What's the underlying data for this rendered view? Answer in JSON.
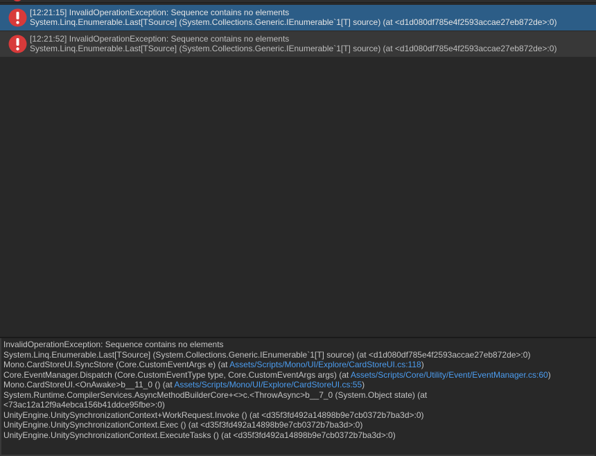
{
  "log_entries": [
    {
      "timestamp": "[12:21:15]",
      "message": "InvalidOperationException: Sequence contains no elements",
      "stack_first": "System.Linq.Enumerable.Last[TSource] (System.Collections.Generic.IEnumerable`1[T] source) (at <d1d080df785e4f2593accae27eb872de>:0)",
      "selected": true,
      "icon": "error-icon"
    },
    {
      "timestamp": "[12:21:52]",
      "message": "InvalidOperationException: Sequence contains no elements",
      "stack_first": "System.Linq.Enumerable.Last[TSource] (System.Collections.Generic.IEnumerable`1[T] source) (at <d1d080df785e4f2593accae27eb872de>:0)",
      "selected": false,
      "icon": "error-icon"
    }
  ],
  "detail": {
    "lines": [
      {
        "text": "InvalidOperationException: Sequence contains no elements"
      },
      {
        "text": "System.Linq.Enumerable.Last[TSource] (System.Collections.Generic.IEnumerable`1[T] source) (at <d1d080df785e4f2593accae27eb872de>:0)"
      },
      {
        "prefix": "Mono.CardStoreUI.SyncStore (Core.CustomEventArgs e) (at ",
        "link": "Assets/Scripts/Mono/UI/Explore/CardStoreUI.cs:118",
        "suffix": ")"
      },
      {
        "prefix": "Core.EventManager.Dispatch (Core.CustomEventType type, Core.CustomEventArgs args) (at ",
        "link": "Assets/Scripts/Core/Utility/Event/EventManager.cs:60",
        "suffix": ")"
      },
      {
        "prefix": "Mono.CardStoreUI.<OnAwake>b__11_0 () (at ",
        "link": "Assets/Scripts/Mono/UI/Explore/CardStoreUI.cs:55",
        "suffix": ")"
      },
      {
        "text": "System.Runtime.CompilerServices.AsyncMethodBuilderCore+<>c.<ThrowAsync>b__7_0 (System.Object state) (at"
      },
      {
        "text": "<73ac12a12f9a4ebca156b41ddce95fbe>:0)"
      },
      {
        "text": "UnityEngine.UnitySynchronizationContext+WorkRequest.Invoke () (at <d35f3fd492a14898b9e7cb0372b7ba3d>:0)"
      },
      {
        "text": "UnityEngine.UnitySynchronizationContext.Exec () (at <d35f3fd492a14898b9e7cb0372b7ba3d>:0)"
      },
      {
        "text": "UnityEngine.UnitySynchronizationContext.ExecuteTasks () (at <d35f3fd492a14898b9e7cb0372b7ba3d>:0)"
      }
    ]
  },
  "colors": {
    "background": "#282828",
    "selected_row": "#2c5d87",
    "normal_row": "#383838",
    "error_icon": "#d83a3a",
    "link": "#4c9df0"
  }
}
